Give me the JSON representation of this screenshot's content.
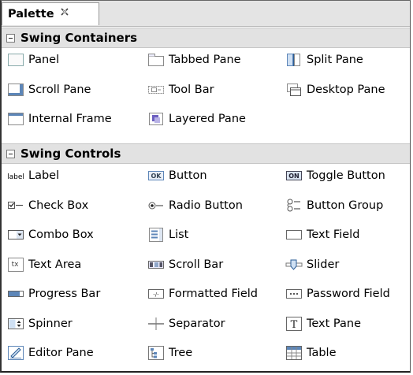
{
  "palette": {
    "title": "Palette",
    "close_icon": "close-icon",
    "sections": [
      {
        "label": "Swing Containers",
        "items": [
          {
            "label": "Panel",
            "icon": "panel-icon"
          },
          {
            "label": "Tabbed Pane",
            "icon": "tabbed-pane-icon"
          },
          {
            "label": "Split Pane",
            "icon": "split-pane-icon"
          },
          {
            "label": "Scroll Pane",
            "icon": "scroll-pane-icon"
          },
          {
            "label": "Tool Bar",
            "icon": "tool-bar-icon"
          },
          {
            "label": "Desktop Pane",
            "icon": "desktop-pane-icon"
          },
          {
            "label": "Internal Frame",
            "icon": "internal-frame-icon"
          },
          {
            "label": "Layered Pane",
            "icon": "layered-pane-icon"
          }
        ]
      },
      {
        "label": "Swing Controls",
        "items": [
          {
            "label": "Label",
            "icon": "label-icon",
            "icon_text": "label"
          },
          {
            "label": "Button",
            "icon": "button-icon",
            "icon_text": "OK"
          },
          {
            "label": "Toggle Button",
            "icon": "toggle-button-icon",
            "icon_text": "ON"
          },
          {
            "label": "Check Box",
            "icon": "check-box-icon"
          },
          {
            "label": "Radio Button",
            "icon": "radio-button-icon"
          },
          {
            "label": "Button Group",
            "icon": "button-group-icon"
          },
          {
            "label": "Combo Box",
            "icon": "combo-box-icon"
          },
          {
            "label": "List",
            "icon": "list-icon"
          },
          {
            "label": "Text Field",
            "icon": "text-field-icon"
          },
          {
            "label": "Text Area",
            "icon": "text-area-icon",
            "icon_text": "tx"
          },
          {
            "label": "Scroll Bar",
            "icon": "scroll-bar-icon"
          },
          {
            "label": "Slider",
            "icon": "slider-icon"
          },
          {
            "label": "Progress Bar",
            "icon": "progress-bar-icon"
          },
          {
            "label": "Formatted Field",
            "icon": "formatted-field-icon",
            "icon_text": "-/-"
          },
          {
            "label": "Password Field",
            "icon": "password-field-icon",
            "icon_text": "•••"
          },
          {
            "label": "Spinner",
            "icon": "spinner-icon"
          },
          {
            "label": "Separator",
            "icon": "separator-icon"
          },
          {
            "label": "Text Pane",
            "icon": "text-pane-icon",
            "icon_text": "T"
          },
          {
            "label": "Editor Pane",
            "icon": "editor-pane-icon"
          },
          {
            "label": "Tree",
            "icon": "tree-icon"
          },
          {
            "label": "Table",
            "icon": "table-icon"
          }
        ]
      }
    ]
  }
}
